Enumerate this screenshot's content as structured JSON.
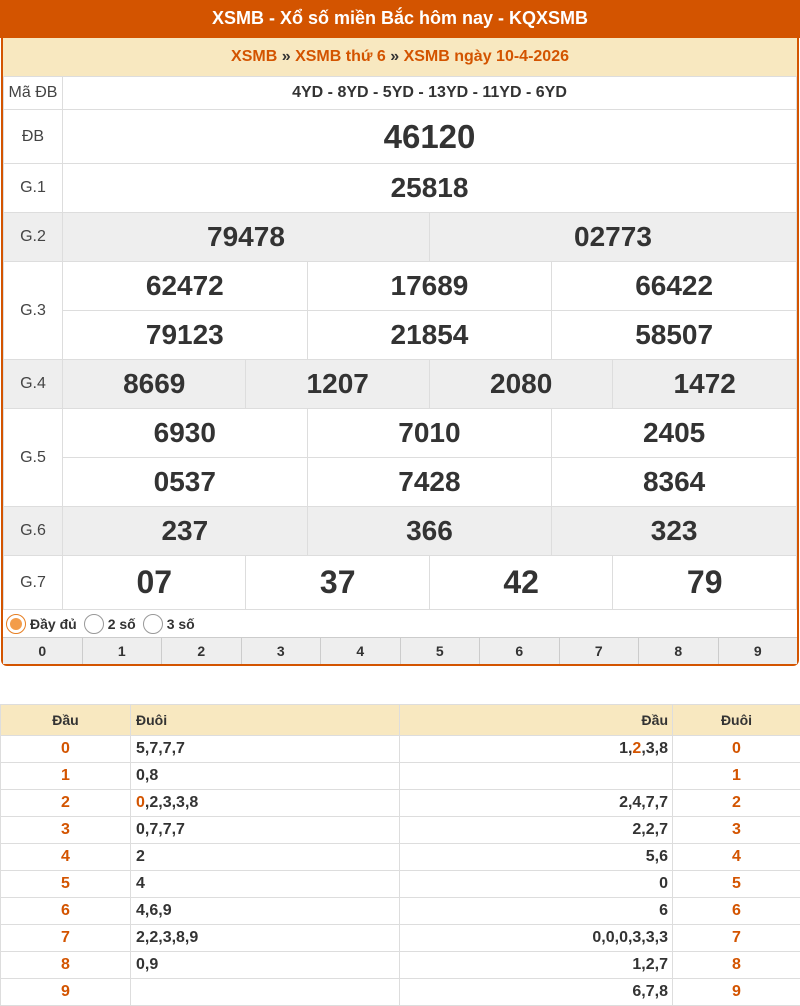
{
  "title": "XSMB - Xổ số miền Bắc hôm nay - KQXSMB",
  "breadcrumb": {
    "l1": "XSMB",
    "sep1": "»",
    "l2": "XSMB thứ 6",
    "sep2": "»",
    "l3": "XSMB ngày 10-4-2026"
  },
  "labels": {
    "madb": "Mã ĐB",
    "db": "ĐB",
    "g1": "G.1",
    "g2": "G.2",
    "g3": "G.3",
    "g4": "G.4",
    "g5": "G.5",
    "g6": "G.6",
    "g7": "G.7"
  },
  "madb": "4YD - 8YD - 5YD - 13YD - 11YD - 6YD",
  "db": "46120",
  "g1": "25818",
  "g2": [
    "79478",
    "02773"
  ],
  "g3": [
    "62472",
    "17689",
    "66422",
    "79123",
    "21854",
    "58507"
  ],
  "g4": [
    "8669",
    "1207",
    "2080",
    "1472"
  ],
  "g5": [
    "6930",
    "7010",
    "2405",
    "0537",
    "7428",
    "8364"
  ],
  "g6": [
    "237",
    "366",
    "323"
  ],
  "g7": [
    "07",
    "37",
    "42",
    "79"
  ],
  "options": {
    "full": "Đầy đủ",
    "two": "2 số",
    "three": "3 số",
    "selected": "full"
  },
  "digits": [
    "0",
    "1",
    "2",
    "3",
    "4",
    "5",
    "6",
    "7",
    "8",
    "9"
  ],
  "loto": {
    "headers": [
      "Đầu",
      "Đuôi",
      "Đầu",
      "Đuôi"
    ],
    "rows": [
      {
        "dau": "0",
        "duoi": [
          {
            "t": "5,7,7,7"
          }
        ],
        "dau2": [
          {
            "t": "1,"
          },
          {
            "t": "2",
            "h": true
          },
          {
            "t": ",3,8"
          }
        ],
        "duoi2": "0"
      },
      {
        "dau": "1",
        "duoi": [
          {
            "t": "0,8"
          }
        ],
        "dau2": [
          {
            "t": ""
          }
        ],
        "duoi2": "1"
      },
      {
        "dau": "2",
        "duoi": [
          {
            "t": "0",
            "h": true
          },
          {
            "t": ",2,3,3,8"
          }
        ],
        "dau2": [
          {
            "t": "2,4,7,7"
          }
        ],
        "duoi2": "2"
      },
      {
        "dau": "3",
        "duoi": [
          {
            "t": "0,7,7,7"
          }
        ],
        "dau2": [
          {
            "t": "2,2,7"
          }
        ],
        "duoi2": "3"
      },
      {
        "dau": "4",
        "duoi": [
          {
            "t": "2"
          }
        ],
        "dau2": [
          {
            "t": "5,6"
          }
        ],
        "duoi2": "4"
      },
      {
        "dau": "5",
        "duoi": [
          {
            "t": "4"
          }
        ],
        "dau2": [
          {
            "t": "0"
          }
        ],
        "duoi2": "5"
      },
      {
        "dau": "6",
        "duoi": [
          {
            "t": "4,6,9"
          }
        ],
        "dau2": [
          {
            "t": "6"
          }
        ],
        "duoi2": "6"
      },
      {
        "dau": "7",
        "duoi": [
          {
            "t": "2,2,3,8,9"
          }
        ],
        "dau2": [
          {
            "t": "0,0,0,3,3,3"
          }
        ],
        "duoi2": "7"
      },
      {
        "dau": "8",
        "duoi": [
          {
            "t": "0,9"
          }
        ],
        "dau2": [
          {
            "t": "1,2,7"
          }
        ],
        "duoi2": "8"
      },
      {
        "dau": "9",
        "duoi": [
          {
            "t": ""
          }
        ],
        "dau2": [
          {
            "t": "6,7,8"
          }
        ],
        "duoi2": "9"
      }
    ]
  },
  "colors": {
    "accent": "#d35400",
    "header_bg": "#f8e8c0",
    "madb": "#1565c0"
  }
}
